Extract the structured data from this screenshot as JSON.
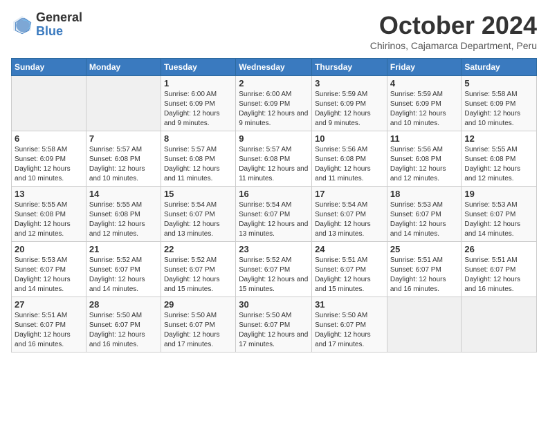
{
  "logo": {
    "general": "General",
    "blue": "Blue"
  },
  "header": {
    "month": "October 2024",
    "location": "Chirinos, Cajamarca Department, Peru"
  },
  "days_of_week": [
    "Sunday",
    "Monday",
    "Tuesday",
    "Wednesday",
    "Thursday",
    "Friday",
    "Saturday"
  ],
  "weeks": [
    [
      {
        "day": "",
        "info": ""
      },
      {
        "day": "",
        "info": ""
      },
      {
        "day": "1",
        "info": "Sunrise: 6:00 AM\nSunset: 6:09 PM\nDaylight: 12 hours and 9 minutes."
      },
      {
        "day": "2",
        "info": "Sunrise: 6:00 AM\nSunset: 6:09 PM\nDaylight: 12 hours and 9 minutes."
      },
      {
        "day": "3",
        "info": "Sunrise: 5:59 AM\nSunset: 6:09 PM\nDaylight: 12 hours and 9 minutes."
      },
      {
        "day": "4",
        "info": "Sunrise: 5:59 AM\nSunset: 6:09 PM\nDaylight: 12 hours and 10 minutes."
      },
      {
        "day": "5",
        "info": "Sunrise: 5:58 AM\nSunset: 6:09 PM\nDaylight: 12 hours and 10 minutes."
      }
    ],
    [
      {
        "day": "6",
        "info": "Sunrise: 5:58 AM\nSunset: 6:09 PM\nDaylight: 12 hours and 10 minutes."
      },
      {
        "day": "7",
        "info": "Sunrise: 5:57 AM\nSunset: 6:08 PM\nDaylight: 12 hours and 10 minutes."
      },
      {
        "day": "8",
        "info": "Sunrise: 5:57 AM\nSunset: 6:08 PM\nDaylight: 12 hours and 11 minutes."
      },
      {
        "day": "9",
        "info": "Sunrise: 5:57 AM\nSunset: 6:08 PM\nDaylight: 12 hours and 11 minutes."
      },
      {
        "day": "10",
        "info": "Sunrise: 5:56 AM\nSunset: 6:08 PM\nDaylight: 12 hours and 11 minutes."
      },
      {
        "day": "11",
        "info": "Sunrise: 5:56 AM\nSunset: 6:08 PM\nDaylight: 12 hours and 12 minutes."
      },
      {
        "day": "12",
        "info": "Sunrise: 5:55 AM\nSunset: 6:08 PM\nDaylight: 12 hours and 12 minutes."
      }
    ],
    [
      {
        "day": "13",
        "info": "Sunrise: 5:55 AM\nSunset: 6:08 PM\nDaylight: 12 hours and 12 minutes."
      },
      {
        "day": "14",
        "info": "Sunrise: 5:55 AM\nSunset: 6:08 PM\nDaylight: 12 hours and 12 minutes."
      },
      {
        "day": "15",
        "info": "Sunrise: 5:54 AM\nSunset: 6:07 PM\nDaylight: 12 hours and 13 minutes."
      },
      {
        "day": "16",
        "info": "Sunrise: 5:54 AM\nSunset: 6:07 PM\nDaylight: 12 hours and 13 minutes."
      },
      {
        "day": "17",
        "info": "Sunrise: 5:54 AM\nSunset: 6:07 PM\nDaylight: 12 hours and 13 minutes."
      },
      {
        "day": "18",
        "info": "Sunrise: 5:53 AM\nSunset: 6:07 PM\nDaylight: 12 hours and 14 minutes."
      },
      {
        "day": "19",
        "info": "Sunrise: 5:53 AM\nSunset: 6:07 PM\nDaylight: 12 hours and 14 minutes."
      }
    ],
    [
      {
        "day": "20",
        "info": "Sunrise: 5:53 AM\nSunset: 6:07 PM\nDaylight: 12 hours and 14 minutes."
      },
      {
        "day": "21",
        "info": "Sunrise: 5:52 AM\nSunset: 6:07 PM\nDaylight: 12 hours and 14 minutes."
      },
      {
        "day": "22",
        "info": "Sunrise: 5:52 AM\nSunset: 6:07 PM\nDaylight: 12 hours and 15 minutes."
      },
      {
        "day": "23",
        "info": "Sunrise: 5:52 AM\nSunset: 6:07 PM\nDaylight: 12 hours and 15 minutes."
      },
      {
        "day": "24",
        "info": "Sunrise: 5:51 AM\nSunset: 6:07 PM\nDaylight: 12 hours and 15 minutes."
      },
      {
        "day": "25",
        "info": "Sunrise: 5:51 AM\nSunset: 6:07 PM\nDaylight: 12 hours and 16 minutes."
      },
      {
        "day": "26",
        "info": "Sunrise: 5:51 AM\nSunset: 6:07 PM\nDaylight: 12 hours and 16 minutes."
      }
    ],
    [
      {
        "day": "27",
        "info": "Sunrise: 5:51 AM\nSunset: 6:07 PM\nDaylight: 12 hours and 16 minutes."
      },
      {
        "day": "28",
        "info": "Sunrise: 5:50 AM\nSunset: 6:07 PM\nDaylight: 12 hours and 16 minutes."
      },
      {
        "day": "29",
        "info": "Sunrise: 5:50 AM\nSunset: 6:07 PM\nDaylight: 12 hours and 17 minutes."
      },
      {
        "day": "30",
        "info": "Sunrise: 5:50 AM\nSunset: 6:07 PM\nDaylight: 12 hours and 17 minutes."
      },
      {
        "day": "31",
        "info": "Sunrise: 5:50 AM\nSunset: 6:07 PM\nDaylight: 12 hours and 17 minutes."
      },
      {
        "day": "",
        "info": ""
      },
      {
        "day": "",
        "info": ""
      }
    ]
  ]
}
